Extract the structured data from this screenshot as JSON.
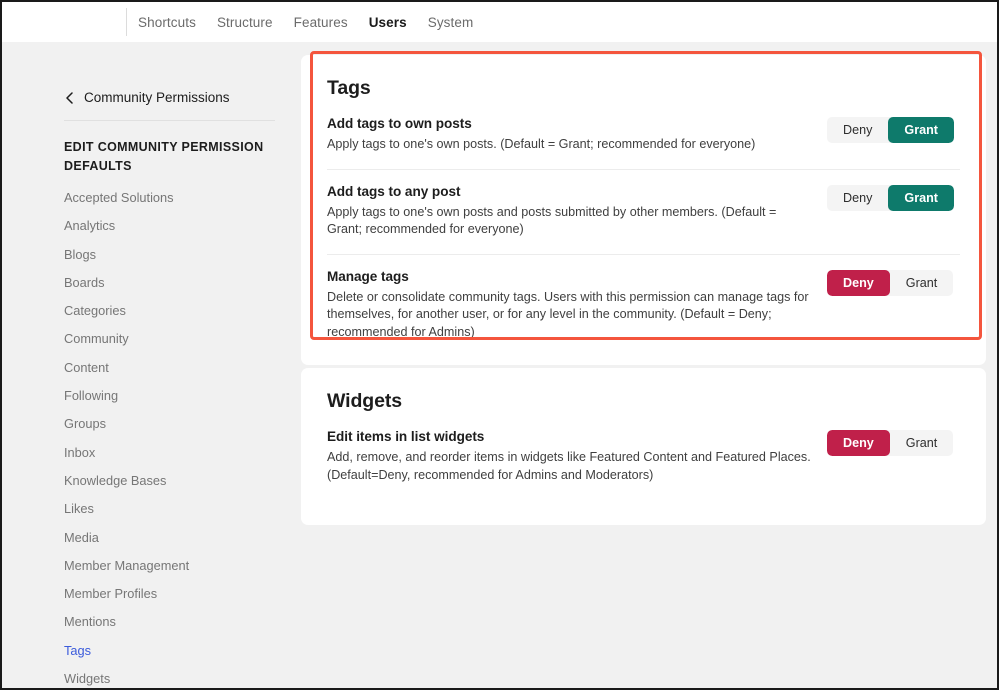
{
  "topnav": {
    "items": [
      {
        "label": "Shortcuts",
        "active": false
      },
      {
        "label": "Structure",
        "active": false
      },
      {
        "label": "Features",
        "active": false
      },
      {
        "label": "Users",
        "active": true
      },
      {
        "label": "System",
        "active": false
      }
    ]
  },
  "sidebar": {
    "back_label": "Community Permissions",
    "back_icon": "chevron-left-icon",
    "section_title": "EDIT COMMUNITY PERMISSION DEFAULTS",
    "items": [
      {
        "label": "Accepted Solutions",
        "active": false
      },
      {
        "label": "Analytics",
        "active": false
      },
      {
        "label": "Blogs",
        "active": false
      },
      {
        "label": "Boards",
        "active": false
      },
      {
        "label": "Categories",
        "active": false
      },
      {
        "label": "Community",
        "active": false
      },
      {
        "label": "Content",
        "active": false
      },
      {
        "label": "Following",
        "active": false
      },
      {
        "label": "Groups",
        "active": false
      },
      {
        "label": "Inbox",
        "active": false
      },
      {
        "label": "Knowledge Bases",
        "active": false
      },
      {
        "label": "Likes",
        "active": false
      },
      {
        "label": "Media",
        "active": false
      },
      {
        "label": "Member Management",
        "active": false
      },
      {
        "label": "Member Profiles",
        "active": false
      },
      {
        "label": "Mentions",
        "active": false
      },
      {
        "label": "Tags",
        "active": true
      },
      {
        "label": "Widgets",
        "active": false
      }
    ]
  },
  "toggle_labels": {
    "deny": "Deny",
    "grant": "Grant"
  },
  "cards": [
    {
      "id": "tags-card",
      "title": "Tags",
      "highlighted": true,
      "rows": [
        {
          "name": "Add tags to own posts",
          "description": "Apply tags to one's own posts. (Default = Grant; recommended for everyone)",
          "selected": "grant"
        },
        {
          "name": "Add tags to any post",
          "description": "Apply tags to one's own posts and posts submitted by other members. (Default = Grant; recommended for everyone)",
          "selected": "grant"
        },
        {
          "name": "Manage tags",
          "description": "Delete or consolidate community tags. Users with this permission can manage tags for themselves, for another user, or for any level in the community. (Default = Deny; recommended for Admins)",
          "selected": "deny"
        }
      ]
    },
    {
      "id": "widgets-card",
      "title": "Widgets",
      "highlighted": false,
      "rows": [
        {
          "name": "Edit items in list widgets",
          "description": "Add, remove, and reorder items in widgets like Featured Content and Featured Places. (Default=Deny, recommended for Admins and Moderators)",
          "selected": "deny"
        }
      ]
    }
  ],
  "colors": {
    "grant_active": "#0e7a6b",
    "deny_active": "#c0204a",
    "annotation": "#f4553d",
    "sidebar_active": "#3b5bdb",
    "page_bg": "#f1f1f1"
  }
}
